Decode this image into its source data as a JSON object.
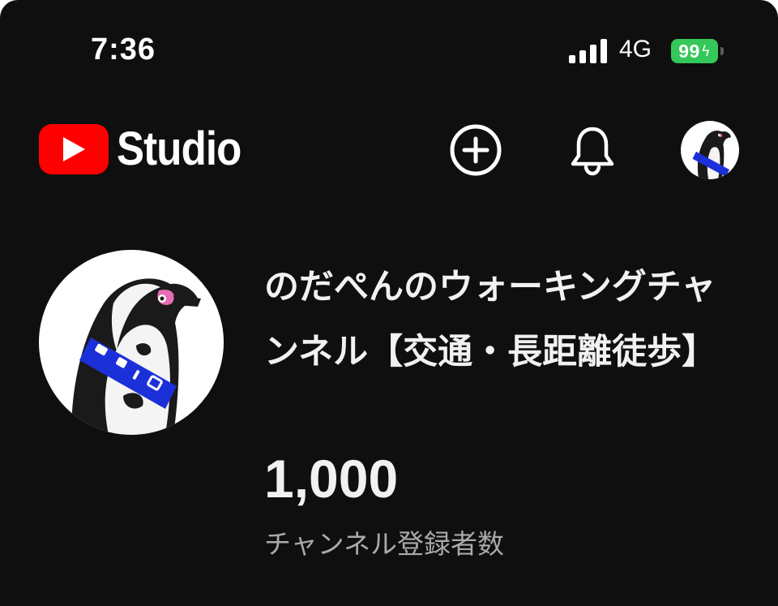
{
  "status_bar": {
    "time": "7:36",
    "network": "4G",
    "battery": "99",
    "battery_color": "#34c759"
  },
  "header": {
    "logo_text": "Studio",
    "brand_color": "#ff0000",
    "icons": [
      "youtube-play-icon",
      "create-plus-icon",
      "notification-bell-icon",
      "account-avatar"
    ]
  },
  "channel": {
    "name": "のだぺんのウォーキングチャンネル【交通・長距離徒歩】",
    "subscriber_count": "1,000",
    "subscriber_label": "チャンネル登録者数",
    "avatar": "penguin-avatar"
  }
}
